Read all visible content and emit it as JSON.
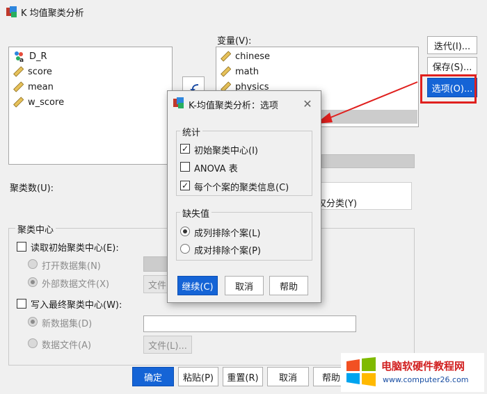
{
  "window": {
    "title": "K 均值聚类分析"
  },
  "source_list": {
    "items": [
      {
        "label": "D_R",
        "icon": "nominal-variable-icon"
      },
      {
        "label": "score",
        "icon": "scale-variable-icon"
      },
      {
        "label": "mean",
        "icon": "scale-variable-icon"
      },
      {
        "label": "w_score",
        "icon": "scale-variable-icon"
      }
    ]
  },
  "variables": {
    "label": "变量(V):",
    "items": [
      "chinese",
      "math",
      "physics"
    ]
  },
  "side_buttons": {
    "iterate": "迭代(I)...",
    "save": "保存(S)...",
    "options": "选项(O)..."
  },
  "clusters": {
    "label": "聚类数(U):"
  },
  "method_partial": "仅分类(Y)",
  "cluster_centers": {
    "title": "聚类中心",
    "read_initial": "读取初始聚类中心(E):",
    "open_dataset": "打开数据集(N)",
    "external_file": "外部数据文件(X)",
    "file_button_partial": "文件",
    "write_final": "写入最终聚类中心(W):",
    "new_dataset": "新数据集(D)",
    "data_file": "数据文件(A)",
    "file_button": "文件(L)..."
  },
  "bottom_buttons": {
    "ok": "确定",
    "paste": "粘贴(P)",
    "reset": "重置(R)",
    "cancel": "取消",
    "help": "帮助"
  },
  "dialog": {
    "title": "K-均值聚类分析：选项",
    "stats_title": "统计",
    "initial_centers": "初始聚类中心(I)",
    "anova": "ANOVA 表",
    "cluster_info": "每个个案的聚类信息(C)",
    "missing_title": "缺失值",
    "listwise": "成列排除个案(L)",
    "pairwise": "成对排除个案(P)",
    "continue": "继续(C)",
    "cancel": "取消",
    "help": "帮助"
  },
  "watermark": {
    "title": "电脑软硬件教程网",
    "url": "www.computer26.com"
  }
}
